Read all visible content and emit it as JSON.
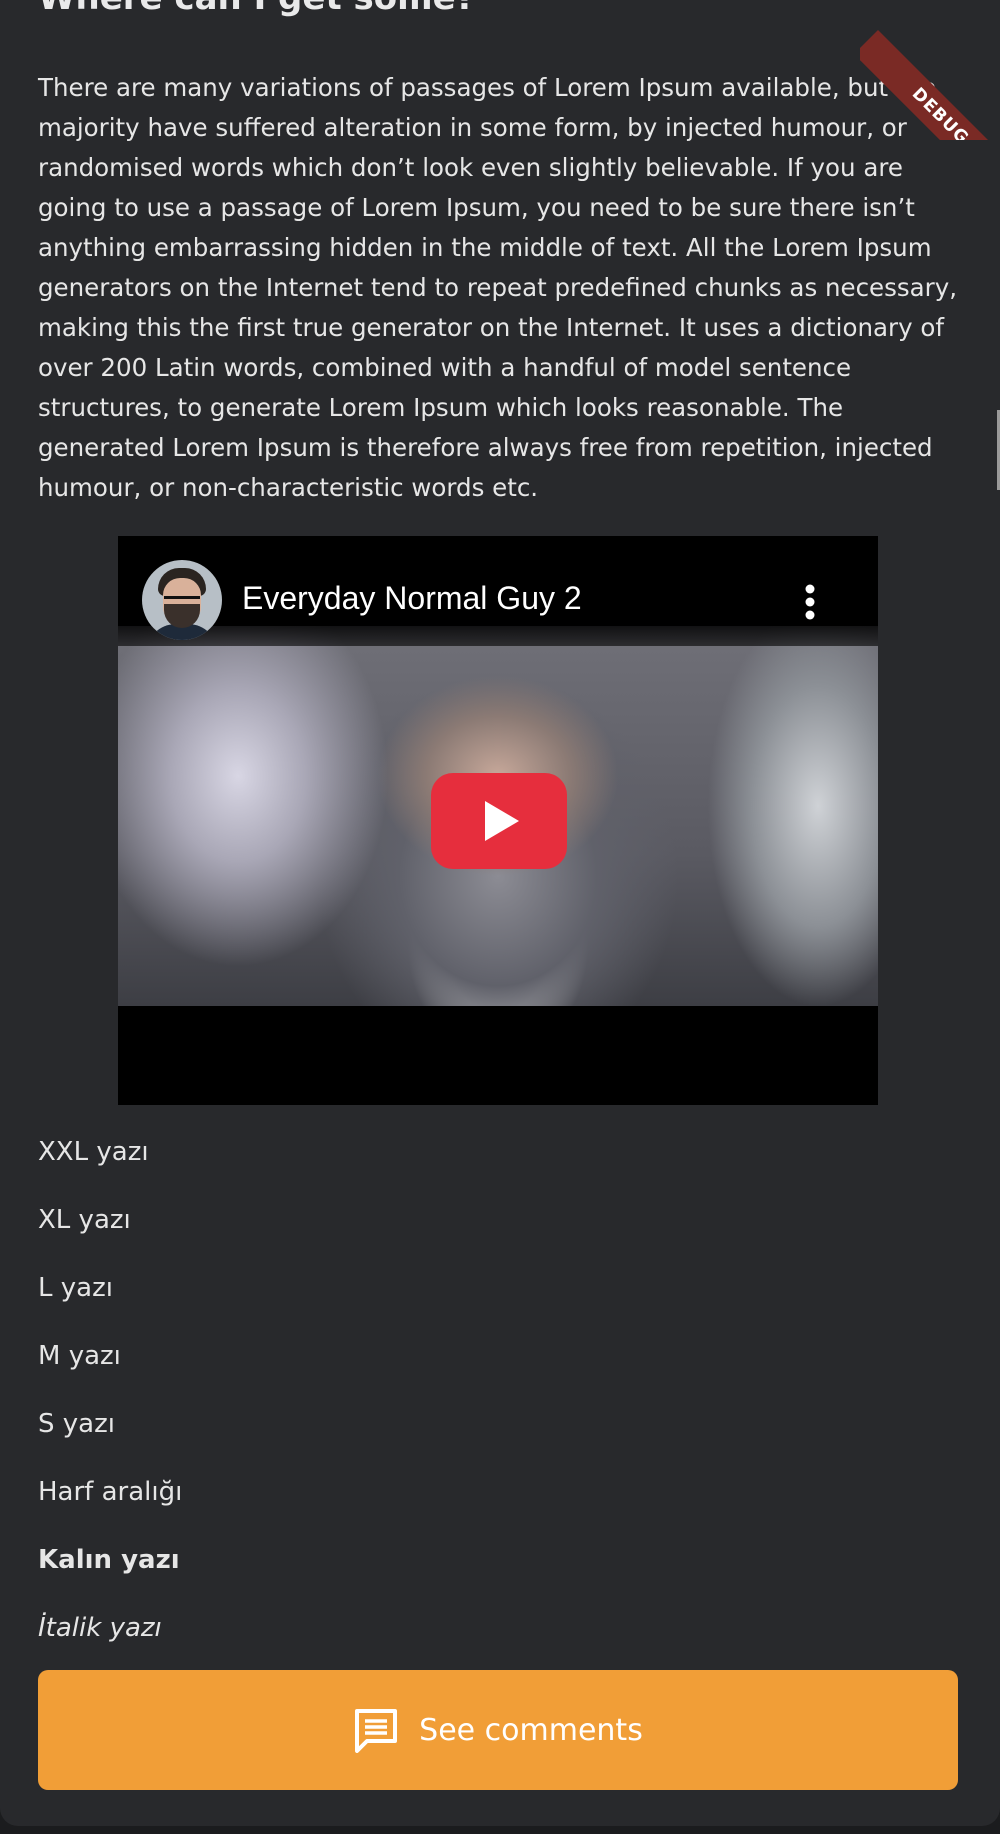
{
  "article": {
    "heading": "Where can I get some?",
    "body": "There are many variations of passages of Lorem Ipsum available, but the majority have suffered alteration in some form, by injected humour, or randomised words which don’t look even slightly believable. If you are going to use a passage of Lorem Ipsum, you need to be sure there isn’t anything embarrassing hidden in the middle of text. All the Lorem Ipsum generators on the Internet tend to repeat predefined chunks as necessary, making this the first true generator on the Internet. It uses a dictionary of over 200 Latin words, combined with a handful of model sentence structures, to generate Lorem Ipsum which looks reasonable. The generated Lorem Ipsum is therefore always free from repetition, injected humour, or non-characteristic words etc."
  },
  "video": {
    "title": "Everyday Normal Guy 2",
    "channel_avatar_icon": "channel-avatar",
    "menu_icon": "more-vert-icon",
    "play_icon": "youtube-play-icon",
    "play_color": "#e62e3d"
  },
  "text_styles": {
    "xxl": "XXL yazı",
    "xl": "XL yazı",
    "l": "L yazı",
    "m": "M yazı",
    "s": "S yazı",
    "letter_spacing": "Harf aralığı",
    "bold": "Kalın yazı",
    "italic": "İtalik yazı"
  },
  "comments_button": {
    "label": "See comments",
    "icon": "comment-icon",
    "color": "#f19e37"
  },
  "debug_banner": {
    "label": "DEBUG",
    "color": "#7a2a25"
  }
}
